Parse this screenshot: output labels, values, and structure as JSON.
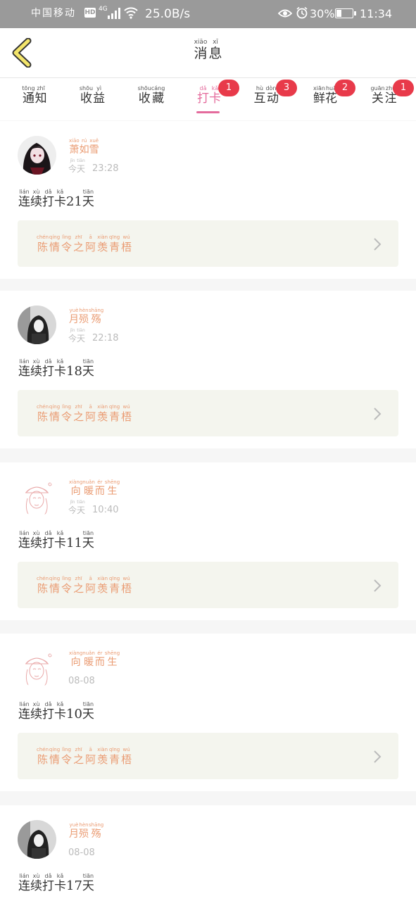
{
  "status_bar": {
    "carrier": "中国移动",
    "network": "4G",
    "hd": "HD",
    "speed": "25.0B/s",
    "battery": "30%",
    "time": "11:34"
  },
  "header": {
    "title": [
      {
        "py": "xiāo",
        "hz": "消"
      },
      {
        "py": "xī",
        "hz": "息"
      }
    ]
  },
  "tabs": [
    {
      "chars": [
        {
          "py": "tōng",
          "hz": "通"
        },
        {
          "py": "zhī",
          "hz": "知"
        }
      ],
      "badge": ""
    },
    {
      "chars": [
        {
          "py": "shōu",
          "hz": "收"
        },
        {
          "py": "yì",
          "hz": "益"
        }
      ],
      "badge": ""
    },
    {
      "chars": [
        {
          "py": "shōu",
          "hz": "收"
        },
        {
          "py": "cáng",
          "hz": "藏"
        }
      ],
      "badge": ""
    },
    {
      "chars": [
        {
          "py": "dǎ",
          "hz": "打"
        },
        {
          "py": "kǎ",
          "hz": "卡"
        }
      ],
      "badge": "1",
      "active": true
    },
    {
      "chars": [
        {
          "py": "hù",
          "hz": "互"
        },
        {
          "py": "dòng",
          "hz": "动"
        }
      ],
      "badge": "3"
    },
    {
      "chars": [
        {
          "py": "xiān",
          "hz": "鲜"
        },
        {
          "py": "huā",
          "hz": "花"
        }
      ],
      "badge": "2"
    },
    {
      "chars": [
        {
          "py": "guān",
          "hz": "关"
        },
        {
          "py": "zhù",
          "hz": "注"
        }
      ],
      "badge": "1"
    }
  ],
  "streak_prefix": [
    {
      "py": "lián",
      "hz": "连"
    },
    {
      "py": "xù",
      "hz": "续"
    },
    {
      "py": "dǎ",
      "hz": "打"
    },
    {
      "py": "kǎ",
      "hz": "卡"
    }
  ],
  "streak_suffix": {
    "py": "tiān",
    "hz": "天"
  },
  "book_title": [
    {
      "py": "chén",
      "hz": "陈"
    },
    {
      "py": "qíng",
      "hz": "情"
    },
    {
      "py": "lìng",
      "hz": "令"
    },
    {
      "py": "zhī",
      "hz": "之"
    },
    {
      "py": "ā",
      "hz": "阿"
    },
    {
      "py": "xiàn",
      "hz": "羡"
    },
    {
      "py": "qīng",
      "hz": "青"
    },
    {
      "py": "wú",
      "hz": "梧"
    }
  ],
  "today_label": [
    {
      "py": "jīn",
      "hz": "今"
    },
    {
      "py": "tiān",
      "hz": "天"
    }
  ],
  "messages": [
    {
      "avatar": "avatar-dark-girl",
      "name": [
        {
          "py": "xiāo",
          "hz": "萧"
        },
        {
          "py": "rú",
          "hz": "如"
        },
        {
          "py": "xuě",
          "hz": "雪"
        }
      ],
      "today": true,
      "time": "23:28",
      "days": "21"
    },
    {
      "avatar": "avatar-bw-girl",
      "name": [
        {
          "py": "yuè",
          "hz": "月"
        },
        {
          "py": "hèn",
          "hz": "殒"
        },
        {
          "py": "shāng",
          "hz": "殇"
        }
      ],
      "today": true,
      "time": "22:18",
      "days": "18"
    },
    {
      "avatar": "avatar-sketch-girl",
      "name": [
        {
          "py": "xiàng",
          "hz": "向"
        },
        {
          "py": "nuǎn",
          "hz": "暖"
        },
        {
          "py": "ér",
          "hz": "而"
        },
        {
          "py": "shēng",
          "hz": "生"
        }
      ],
      "today": true,
      "time": "10:40",
      "days": "11"
    },
    {
      "avatar": "avatar-sketch-girl",
      "name": [
        {
          "py": "xiàng",
          "hz": "向"
        },
        {
          "py": "nuǎn",
          "hz": "暖"
        },
        {
          "py": "ér",
          "hz": "而"
        },
        {
          "py": "shēng",
          "hz": "生"
        }
      ],
      "today": false,
      "time": "08-08",
      "days": "10"
    },
    {
      "avatar": "avatar-bw-girl",
      "name": [
        {
          "py": "yuè",
          "hz": "月"
        },
        {
          "py": "hèn",
          "hz": "殒"
        },
        {
          "py": "shāng",
          "hz": "殇"
        }
      ],
      "today": false,
      "time": "08-08",
      "days": "17"
    }
  ],
  "colors": {
    "accent": "#e46b9c",
    "badge": "#e83a4a",
    "orange": "#ea9b72",
    "book_bg": "#f4f5ee",
    "status_bg": "#9a9a9a"
  }
}
